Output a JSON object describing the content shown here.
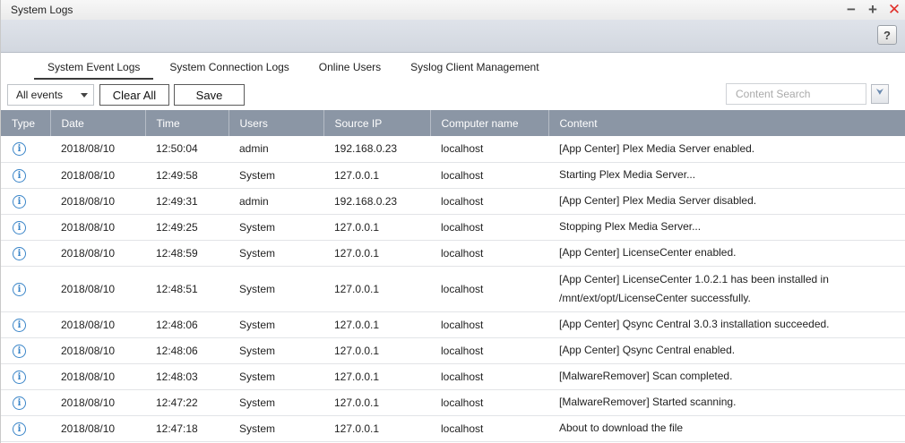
{
  "window": {
    "title": "System Logs",
    "controls": {
      "minimize": "−",
      "maximize": "+",
      "close": "✕"
    }
  },
  "toolbar": {
    "help_label": "?"
  },
  "tabs": [
    {
      "label": "System Event Logs",
      "active": true
    },
    {
      "label": "System Connection Logs",
      "active": false
    },
    {
      "label": "Online Users",
      "active": false
    },
    {
      "label": "Syslog Client Management",
      "active": false
    }
  ],
  "filters": {
    "event_filter": "All events",
    "clear_all_label": "Clear All",
    "save_label": "Save",
    "search_placeholder": "Content Search",
    "advanced_icon": "double-chevron-down-icon"
  },
  "table": {
    "columns": [
      "Type",
      "Date",
      "Time",
      "Users",
      "Source IP",
      "Computer name",
      "Content"
    ],
    "rows": [
      {
        "type": "info",
        "date": "2018/08/10",
        "time": "12:50:04",
        "user": "admin",
        "ip": "192.168.0.23",
        "computer": "localhost",
        "content": "[App Center] Plex Media Server enabled."
      },
      {
        "type": "info",
        "date": "2018/08/10",
        "time": "12:49:58",
        "user": "System",
        "ip": "127.0.0.1",
        "computer": "localhost",
        "content": "Starting Plex Media Server..."
      },
      {
        "type": "info",
        "date": "2018/08/10",
        "time": "12:49:31",
        "user": "admin",
        "ip": "192.168.0.23",
        "computer": "localhost",
        "content": "[App Center] Plex Media Server disabled."
      },
      {
        "type": "info",
        "date": "2018/08/10",
        "time": "12:49:25",
        "user": "System",
        "ip": "127.0.0.1",
        "computer": "localhost",
        "content": "Stopping Plex Media Server..."
      },
      {
        "type": "info",
        "date": "2018/08/10",
        "time": "12:48:59",
        "user": "System",
        "ip": "127.0.0.1",
        "computer": "localhost",
        "content": "[App Center] LicenseCenter enabled."
      },
      {
        "type": "info",
        "date": "2018/08/10",
        "time": "12:48:51",
        "user": "System",
        "ip": "127.0.0.1",
        "computer": "localhost",
        "content": "[App Center] LicenseCenter 1.0.2.1 has been installed in /mnt/ext/opt/LicenseCenter successfully.",
        "tall": true
      },
      {
        "type": "info",
        "date": "2018/08/10",
        "time": "12:48:06",
        "user": "System",
        "ip": "127.0.0.1",
        "computer": "localhost",
        "content": "[App Center] Qsync Central 3.0.3 installation succeeded."
      },
      {
        "type": "info",
        "date": "2018/08/10",
        "time": "12:48:06",
        "user": "System",
        "ip": "127.0.0.1",
        "computer": "localhost",
        "content": "[App Center] Qsync Central enabled."
      },
      {
        "type": "info",
        "date": "2018/08/10",
        "time": "12:48:03",
        "user": "System",
        "ip": "127.0.0.1",
        "computer": "localhost",
        "content": "[MalwareRemover] Scan completed."
      },
      {
        "type": "info",
        "date": "2018/08/10",
        "time": "12:47:22",
        "user": "System",
        "ip": "127.0.0.1",
        "computer": "localhost",
        "content": "[MalwareRemover] Started scanning."
      },
      {
        "type": "info",
        "date": "2018/08/10",
        "time": "12:47:18",
        "user": "System",
        "ip": "127.0.0.1",
        "computer": "localhost",
        "content": "About to download the file"
      }
    ]
  },
  "colors": {
    "header_bg": "#8b96a5",
    "info_icon": "#3a85c8",
    "close": "#e0302a"
  }
}
